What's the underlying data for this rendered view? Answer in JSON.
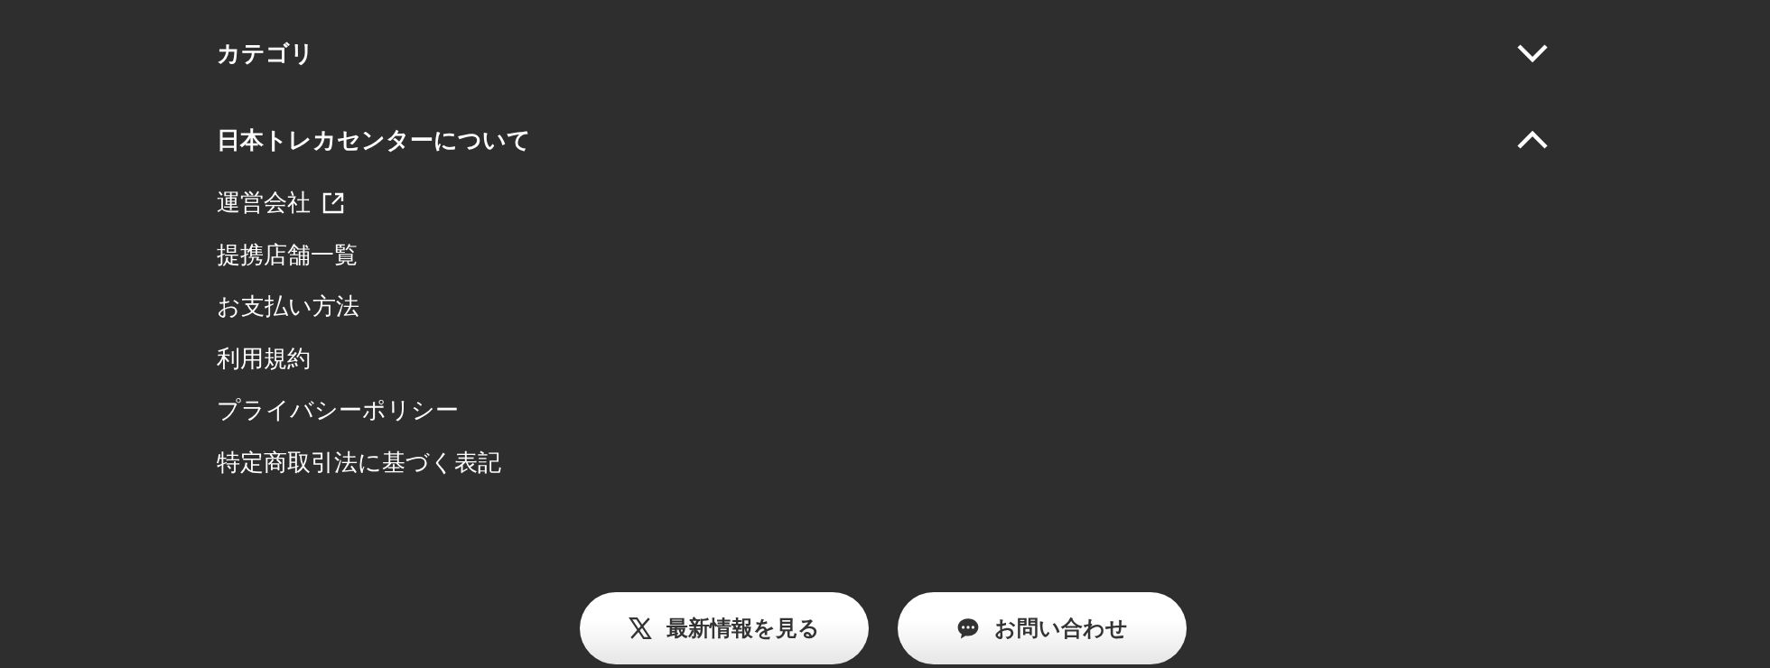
{
  "sections": [
    {
      "title": "カテゴリ",
      "expanded": false
    },
    {
      "title": "日本トレカセンターについて",
      "expanded": true,
      "links": [
        {
          "label": "運営会社",
          "external": true
        },
        {
          "label": "提携店舗一覧",
          "external": false
        },
        {
          "label": "お支払い方法",
          "external": false
        },
        {
          "label": "利用規約",
          "external": false
        },
        {
          "label": "プライバシーポリシー",
          "external": false
        },
        {
          "label": "特定商取引法に基づく表記",
          "external": false
        }
      ]
    }
  ],
  "buttons": [
    {
      "kind": "x",
      "label": "最新情報を見る"
    },
    {
      "kind": "chat",
      "label": "お問い合わせ"
    }
  ]
}
